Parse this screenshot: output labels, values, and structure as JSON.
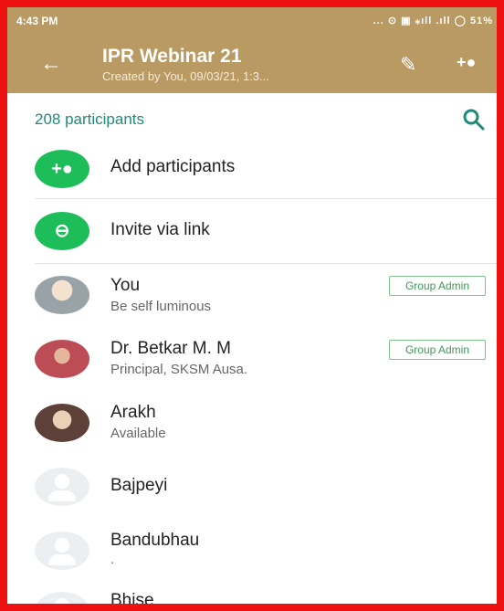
{
  "status": {
    "time": "4:43 PM",
    "icons": "... ⊙ ▣ ⁎ıll .ıll ◯ 51%"
  },
  "header": {
    "back_icon": "arrow-left-icon",
    "title": "IPR Webinar 21",
    "subtitle": "Created by You, 09/03/21, 1:3...",
    "edit_icon": "pencil-icon",
    "add_participant_icon": "add-person-icon"
  },
  "participants": {
    "count_label": "208 participants",
    "search_icon": "search-icon",
    "actions": [
      {
        "label": "Add participants",
        "icon": "add-person-icon"
      },
      {
        "label": "Invite via link",
        "icon": "link-icon"
      }
    ],
    "items": [
      {
        "name": "You",
        "status": "Be self luminous",
        "badge": "Group Admin"
      },
      {
        "name": "Dr. Betkar M. M",
        "status": "Principal, SKSM Ausa.",
        "badge": "Group Admin"
      },
      {
        "name": "Arakh",
        "status": "Available"
      },
      {
        "name": "Bajpeyi",
        "status": ""
      },
      {
        "name": "Bandubhau",
        "status": "."
      },
      {
        "name": "Bhise",
        "status": ""
      }
    ]
  },
  "colors": {
    "header": "#b89a62",
    "accent": "#1f8a7a",
    "action_green": "#1dbd59",
    "badge_green": "#3d9a55",
    "border_red": "#ee1111"
  }
}
